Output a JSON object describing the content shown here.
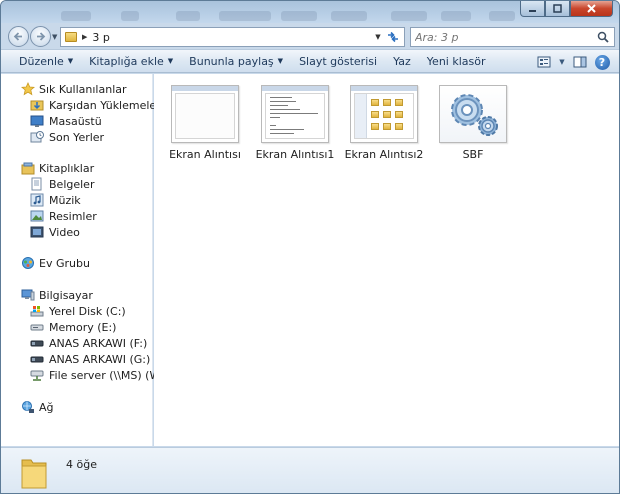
{
  "address": {
    "path": "3 p"
  },
  "search": {
    "placeholder": "Ara: 3 p"
  },
  "toolbar": {
    "organize": "Düzenle",
    "add_to_library": "Kitaplığa ekle",
    "share_with": "Bununla paylaş",
    "slideshow": "Slayt gösterisi",
    "burn": "Yaz",
    "new_folder": "Yeni klasör"
  },
  "sidebar": {
    "favorites": {
      "label": "Sık Kullanılanlar",
      "items": [
        "Karşıdan Yüklemeler",
        "Masaüstü",
        "Son Yerler"
      ]
    },
    "libraries": {
      "label": "Kitaplıklar",
      "items": [
        "Belgeler",
        "Müzik",
        "Resimler",
        "Video"
      ]
    },
    "homegroup": {
      "label": "Ev Grubu"
    },
    "computer": {
      "label": "Bilgisayar",
      "items": [
        "Yerel Disk (C:)",
        "Memory (E:)",
        "ANAS ARKAWI (F:)",
        "ANAS ARKAWI (G:)",
        "File server (\\\\MS) (W:)"
      ]
    },
    "network": {
      "label": "Ağ"
    }
  },
  "files": [
    {
      "name": "Ekran Alıntısı",
      "kind": "blank-screenshot"
    },
    {
      "name": "Ekran Alıntısı1",
      "kind": "code-screenshot"
    },
    {
      "name": "Ekran Alıntısı2",
      "kind": "folder-screenshot"
    },
    {
      "name": "SBF",
      "kind": "gear-icon"
    }
  ],
  "details": {
    "count": "4 öğe"
  },
  "colors": {
    "accent": "#1e395b",
    "window_frame": "#c9d9ea",
    "close_button": "#c9462c"
  }
}
